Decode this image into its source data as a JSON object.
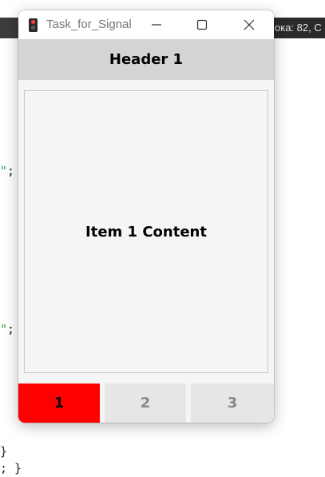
{
  "background": {
    "status_text": "ока: 82, С",
    "code_lines": [
      {
        "str": "\"",
        "rest": ";"
      },
      {
        "str": "\"",
        "rest": ";"
      },
      {
        "str": "",
        "rest": "}"
      },
      {
        "str": "",
        "rest": "; }"
      }
    ]
  },
  "window": {
    "title": "Task_for_Signal",
    "header": "Header 1",
    "content": "Item 1 Content",
    "controls": {
      "minimize_icon": "minimize-icon",
      "maximize_icon": "maximize-icon",
      "close_icon": "close-icon"
    }
  },
  "tabs": [
    {
      "label": "1",
      "active": true
    },
    {
      "label": "2",
      "active": false
    },
    {
      "label": "3",
      "active": false
    }
  ],
  "colors": {
    "active_tab": "#ff0000",
    "inactive_tab": "#e6e6e6",
    "header_bg": "#d4d4d4",
    "string_green": "#2a9d3a"
  }
}
